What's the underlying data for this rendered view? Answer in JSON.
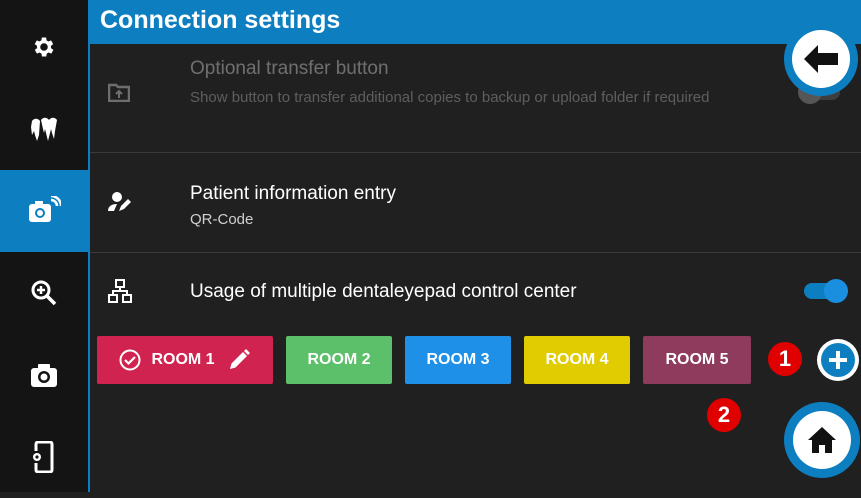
{
  "header": {
    "title": "Connection settings"
  },
  "sidebar": {
    "items": [
      {
        "icon": "gear-icon",
        "active": false
      },
      {
        "icon": "teeth-icon",
        "active": false
      },
      {
        "icon": "camera-wireless-icon",
        "active": true
      },
      {
        "icon": "zoom-in-icon",
        "active": false
      },
      {
        "icon": "camera-icon",
        "active": false
      },
      {
        "icon": "device-settings-icon",
        "active": false
      }
    ]
  },
  "settings": {
    "transfer": {
      "title": "Optional transfer button",
      "subtitle": "Show button to transfer additional copies to backup or upload folder if required",
      "enabled": false
    },
    "patient": {
      "title": "Patient information entry",
      "subtitle": "QR-Code"
    },
    "multiple": {
      "title": "Usage of multiple dentaleyepad control center",
      "enabled": true
    }
  },
  "rooms": [
    {
      "label": "ROOM 1",
      "color": "#d0234f",
      "selected": true
    },
    {
      "label": "ROOM 2",
      "color": "#5cbf6a",
      "selected": false
    },
    {
      "label": "ROOM 3",
      "color": "#1e90e8",
      "selected": false
    },
    {
      "label": "ROOM 4",
      "color": "#e0cc00",
      "selected": false
    },
    {
      "label": "ROOM 5",
      "color": "#8e3b5e",
      "selected": false
    }
  ],
  "badges": {
    "one": "1",
    "two": "2"
  },
  "colors": {
    "accent": "#0d7fc1",
    "badge": "#e00000",
    "background": "#202020",
    "sidebar": "#141414"
  }
}
